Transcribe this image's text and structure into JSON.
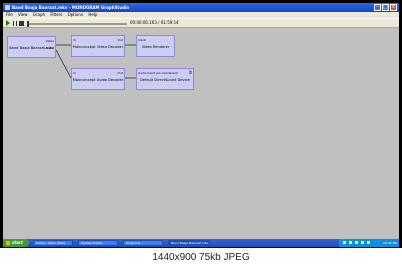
{
  "window": {
    "title": "Band Baaja Baaraat.mkv - MONOGRAM GraphStudio"
  },
  "menu": [
    "File",
    "View",
    "Graph",
    "Filters",
    "Options",
    "Help"
  ],
  "toolbar": {
    "time": "00:00:00.163 / 01:59:14"
  },
  "filters": {
    "source": {
      "name": "Band Baaja Baaraat.mkv",
      "out_video": "Video",
      "out_audio": "Audio"
    },
    "video_decoder": {
      "name": "Mainconcept Video Decoder",
      "in_pin": "In",
      "out_pin": "Out"
    },
    "video_renderer": {
      "name": "Video Renderer",
      "in_pin": "Input"
    },
    "audio_decoder": {
      "name": "Mainconcept Audio Decoder",
      "in_pin": "In",
      "out_pin": "Out"
    },
    "audio_renderer": {
      "name": "Default DirectSound Device",
      "in_pin": "Audio Input pin (rendered)",
      "clock": "⏱"
    }
  },
  "taskbar": {
    "start": "start",
    "tasks": [
      "Gmail - Inbox (860)",
      "Mozilla Firefox",
      "Programs",
      "Band Baaja Baaraat.mkv..."
    ],
    "clock": "10:34 PM"
  },
  "caption": "1440x900  75kb  JPEG"
}
